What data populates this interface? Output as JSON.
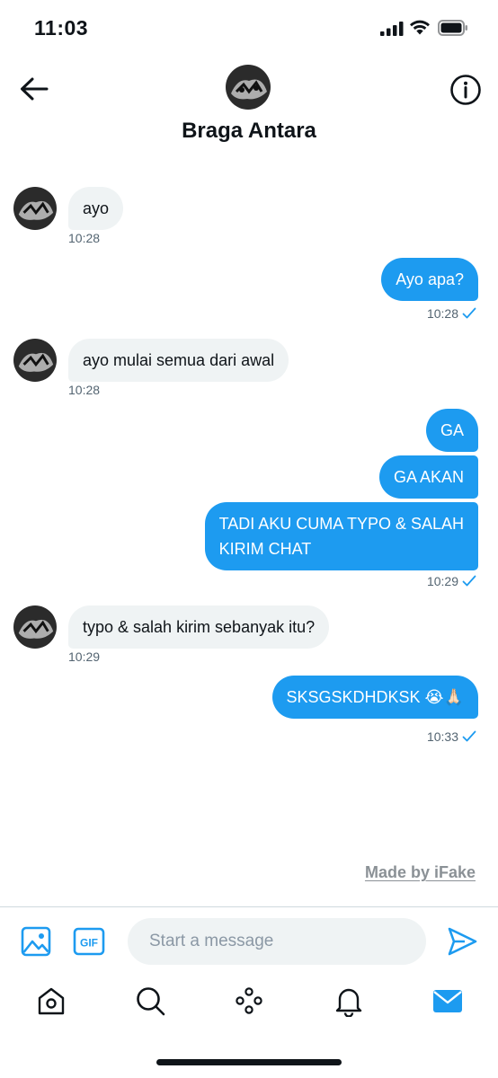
{
  "status_bar": {
    "time": "11:03",
    "icons": [
      "signal-icon",
      "wifi-icon",
      "battery-icon"
    ]
  },
  "header": {
    "contact_name": "Braga Antara",
    "back_icon": "back-arrow-icon",
    "info_icon": "info-icon"
  },
  "messages": [
    {
      "direction": "in",
      "text": "ayo",
      "time": "10:28"
    },
    {
      "direction": "out",
      "text": "Ayo apa?",
      "time": "10:28"
    },
    {
      "direction": "in",
      "text": "ayo mulai semua dari awal",
      "time": "10:28"
    },
    {
      "direction": "out",
      "text": "GA"
    },
    {
      "direction": "out",
      "text": "GA AKAN"
    },
    {
      "direction": "out",
      "text": "TADI AKU CUMA TYPO & SALAH\nKIRIM CHAT",
      "time": "10:29"
    },
    {
      "direction": "in",
      "text": "typo & salah kirim sebanyak itu?",
      "time": "10:29"
    },
    {
      "direction": "out",
      "text": "SKSGSKDHDKSK 😭🙏🏻",
      "time": "10:33"
    }
  ],
  "watermark": "Made by iFake",
  "composer": {
    "placeholder": "Start a message",
    "gif_label": "GIF",
    "icons": [
      "image-icon",
      "gif-icon",
      "send-icon"
    ]
  },
  "tab_bar": {
    "tabs": [
      "home-icon",
      "search-icon",
      "spaces-icon",
      "notifications-icon",
      "messages-icon"
    ],
    "active": "messages-icon"
  },
  "colors": {
    "accent": "#1d9bf0",
    "incoming_bubble": "#eff3f4",
    "text": "#0f1419",
    "secondary_text": "#536471"
  }
}
